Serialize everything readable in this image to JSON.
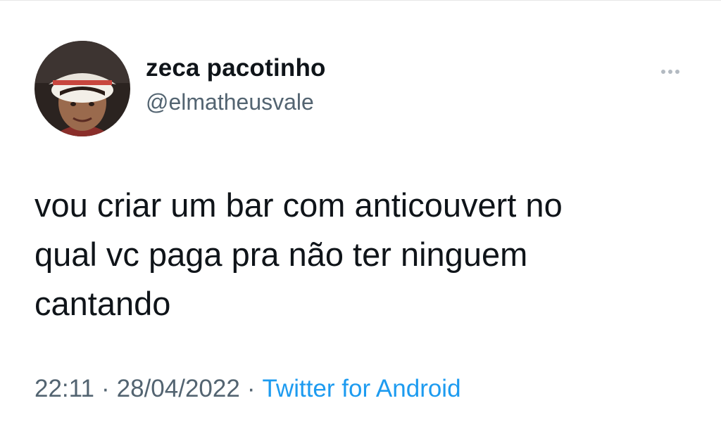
{
  "tweet": {
    "display_name": "zeca pacotinho",
    "handle": "@elmatheusvale",
    "more_icon": "more-horizontal-icon",
    "text": "vou criar um bar com anticouvert no\nqual vc paga pra não ter ninguem\ncantando",
    "time": "22:11",
    "separator": "·",
    "date": "28/04/2022",
    "source": "Twitter for Android"
  },
  "colors": {
    "text_primary": "#0f1419",
    "text_secondary": "#536471",
    "link": "#1d9bf0",
    "background": "#ffffff"
  }
}
